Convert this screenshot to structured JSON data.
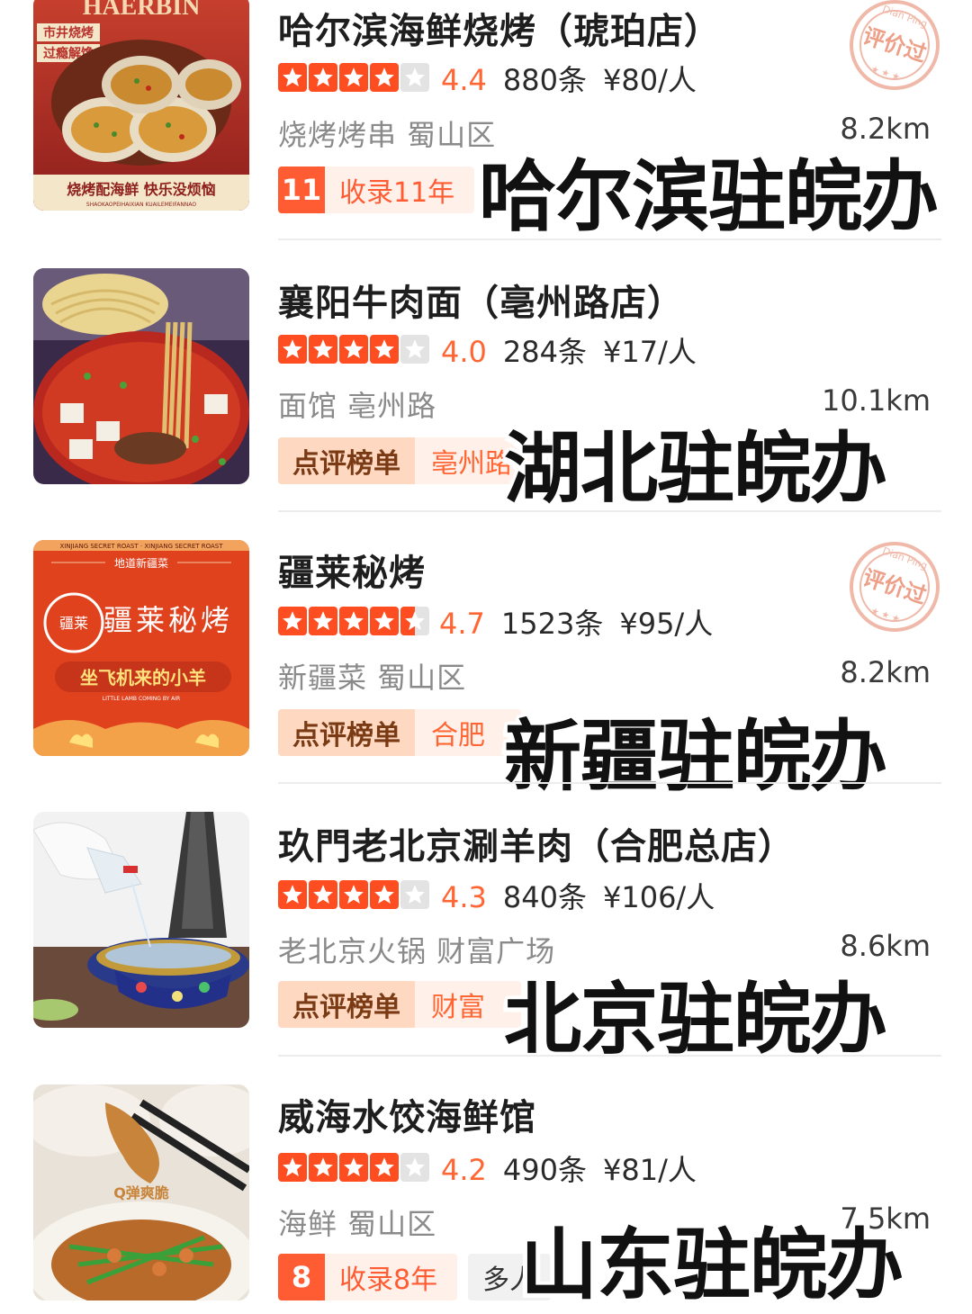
{
  "restaurants": [
    {
      "name": "哈尔滨海鲜烧烤（琥珀店）",
      "score": "4.4",
      "reviews": "880条",
      "price": "¥80/人",
      "category": "烧烤烤串 蜀山区",
      "distance": "8.2km",
      "badge_num": "11",
      "badge_text": "收录11年",
      "overlay": "哈尔滨驻皖办",
      "stamp_text": "评价过",
      "stamp_arc": "Dian Ping",
      "img_text_top": "HAERBIN",
      "img_tag1": "市井烧烤",
      "img_tag2": "过瘾解馋",
      "img_bottom": "烧烤配海鲜 快乐没烦恼",
      "img_bottom_pinyin": "SHAOKAOPEIHAIXIAN   KUAILEMEIFANNAO"
    },
    {
      "name": "襄阳牛肉面（亳州路店）",
      "score": "4.0",
      "reviews": "284条",
      "price": "¥17/人",
      "category": "面馆 亳州路",
      "distance": "10.1km",
      "rank_label": "点评榜单",
      "rank_text": "亳州路",
      "overlay": "湖北驻皖办"
    },
    {
      "name": "疆莱秘烤",
      "score": "4.7",
      "reviews": "1523条",
      "price": "¥95/人",
      "category": "新疆菜 蜀山区",
      "distance": "8.2km",
      "rank_label": "点评榜单",
      "rank_text": "合肥",
      "overlay": "新疆驻皖办",
      "stamp_text": "评价过",
      "stamp_arc": "Dian Ping",
      "img_banner": "XINJIANG SECRET ROAST · XINJIANG SECRET ROAST",
      "img_sub": "地道新疆菜",
      "img_title": "疆莱秘烤",
      "img_logo": "疆莱",
      "img_slogan": "坐飞机来的小羊",
      "img_slogan_en": "LITTLE LAMB COMING BY AIR"
    },
    {
      "name": "玖門老北京涮羊肉（合肥总店）",
      "score": "4.3",
      "reviews": "840条",
      "price": "¥106/人",
      "category": "老北京火锅 财富广场",
      "distance": "8.6km",
      "rank_label": "点评榜单",
      "rank_text": "财富",
      "overlay": "北京驻皖办"
    },
    {
      "name": "威海水饺海鲜馆",
      "score": "4.2",
      "reviews": "490条",
      "price": "¥81/人",
      "category": "海鲜 蜀山区",
      "distance": "7.5km",
      "badge_num": "8",
      "badge_text": "收录8年",
      "extra_tag": "多人",
      "overlay": "山东驻皖办",
      "img_text": "Q弹爽脆"
    }
  ],
  "colors": {
    "star": "#ff4d22",
    "accent": "#ff5c33",
    "score": "#ff6633"
  }
}
